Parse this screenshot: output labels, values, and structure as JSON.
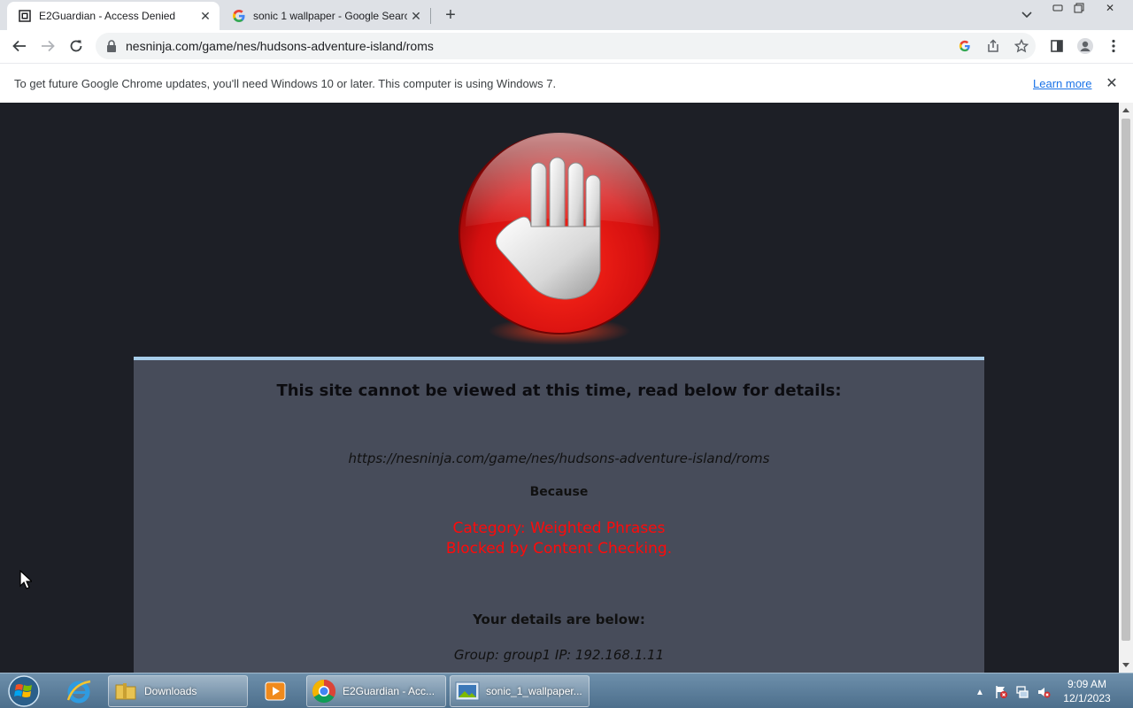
{
  "browser": {
    "tabs": [
      {
        "title": "E2Guardian - Access Denied",
        "icon": "page-icon",
        "active": true
      },
      {
        "title": "sonic 1 wallpaper - Google Search",
        "icon": "google-g-icon",
        "active": false
      }
    ],
    "new_tab_symbol": "+",
    "url": "nesninja.com/game/nes/hudsons-adventure-island/roms"
  },
  "infobar": {
    "message": "To get future Google Chrome updates, you'll need Windows 10 or later. This computer is using Windows 7.",
    "link": "Learn more"
  },
  "page": {
    "heading": "This site cannot be viewed at this time, read below for details:",
    "blocked_url": "https://nesninja.com/game/nes/hudsons-adventure-island/roms",
    "because_label": "Because",
    "reason_line1": "Category: Weighted Phrases",
    "reason_line2": "Blocked by Content Checking.",
    "details_label": "Your details are below:",
    "user_info": "Group: group1   IP: 192.168.1.11"
  },
  "colors": {
    "page_bg": "#1d1f26",
    "panel_bg": "#474c5a",
    "panel_border": "#a7cdea",
    "reason_text": "#ff0a0a",
    "stop_red": "#e01010"
  },
  "taskbar": {
    "items": [
      {
        "label": "Downloads",
        "icon": "folder-icon"
      },
      {
        "label": "E2Guardian - Acc...",
        "icon": "chrome-icon"
      },
      {
        "label": "sonic_1_wallpaper...",
        "icon": "image-viewer-icon"
      }
    ],
    "clock_time": "9:09 AM",
    "clock_date": "12/1/2023"
  }
}
